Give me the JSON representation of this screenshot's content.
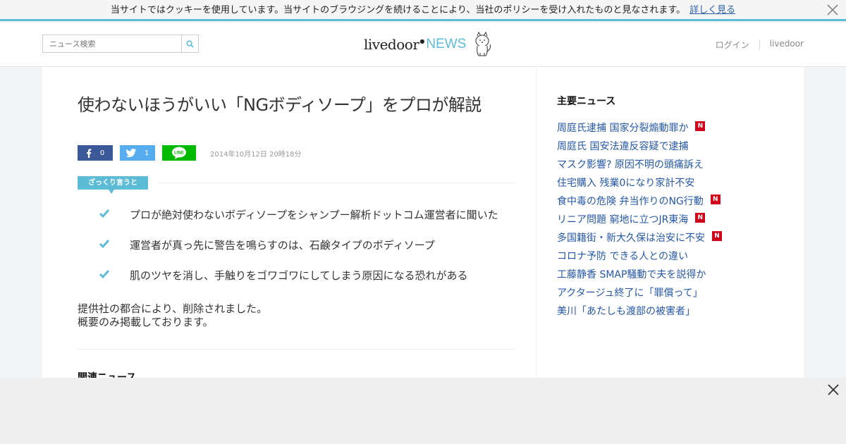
{
  "cookie_bar": {
    "text": "当サイトではクッキーを使用しています。当サイトのブラウジングを続けることにより、当社のポリシーを受け入れたものと見なされます。",
    "more_link": "詳しく見る",
    "close_icon": "close-icon"
  },
  "header": {
    "search_placeholder": "ニュース検索",
    "search_icon": "search-icon",
    "logo_left": "livedoor",
    "logo_right": "NEWS",
    "login": "ログイン",
    "livedoor": "livedoor"
  },
  "article": {
    "title": "使わないほうがいい「NGボディソープ」をプロが解説",
    "share": {
      "facebook_count": "0",
      "twitter_count": "1",
      "line_label": "LINE"
    },
    "date": "2014年10月12日 20時18分",
    "summary_label": "ざっくり言うと",
    "points": [
      "プロが絶対使わないボディソープをシャンプー解析ドットコム運営者に聞いた",
      "運営者が真っ先に警告を鳴らすのは、石鹸タイプのボディソープ",
      "肌のツヤを消し、手触りをゴワゴワにしてしまう原因になる恐れがある"
    ],
    "notice_line1": "提供社の都合により、削除されました。",
    "notice_line2": "概要のみ掲載しております。",
    "related_title": "関連ニュース"
  },
  "sidebar": {
    "title": "主要ニュース",
    "items": [
      {
        "label": "周庭氏逮捕 国家分裂煽動罪か",
        "new": true
      },
      {
        "label": "周庭氏 国安法違反容疑で逮捕",
        "new": false
      },
      {
        "label": "マスク影響? 原因不明の頭痛訴え",
        "new": false
      },
      {
        "label": "住宅購入 残業0になり家計不安",
        "new": false
      },
      {
        "label": "食中毒の危険 弁当作りのNG行動",
        "new": true
      },
      {
        "label": "リニア問題 窮地に立つJR東海",
        "new": true
      },
      {
        "label": "多国籍街・新大久保は治安に不安",
        "new": true
      },
      {
        "label": "コロナ予防 できる人との違い",
        "new": false
      },
      {
        "label": "工藤静香 SMAP騒動で夫を説得か",
        "new": false
      },
      {
        "label": "アクタージュ終了に「罪償って」",
        "new": false
      },
      {
        "label": "美川「あたしも渡部の被害者」",
        "new": false
      }
    ],
    "new_badge": "N"
  },
  "colors": {
    "accent": "#5cbcd6",
    "link": "#2557a7",
    "facebook": "#3b5998",
    "twitter": "#55acee",
    "line": "#00b900",
    "new_badge": "#d0021b"
  }
}
